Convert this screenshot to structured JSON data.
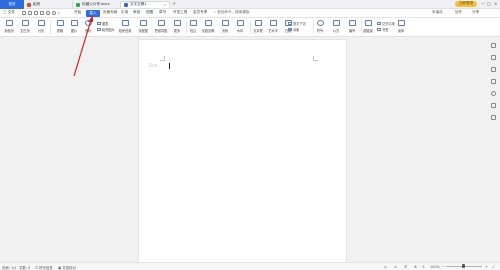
{
  "titlebar": {
    "home_tab": "首页",
    "tabs": [
      {
        "label": "稻壳",
        "color": "#e0442c"
      },
      {
        "label": "珍藏公众号.docx",
        "color": "#2fa84f"
      },
      {
        "label": "文字文稿1",
        "color": "#2d6cdf"
      }
    ],
    "new_tab": "+",
    "login": "立即登录",
    "minimize": "—",
    "maximize": "□",
    "close": "×"
  },
  "menubar": {
    "file": "三 文件",
    "items_left": [
      "开始",
      "插入",
      "页面布局",
      "引用",
      "审阅",
      "视图",
      "章节",
      "开发工具",
      "会员专享"
    ],
    "active": "开始",
    "search": "查找命令、搜索模板",
    "right_links": [
      "未保存",
      "协作",
      "分享"
    ]
  },
  "ribbon": {
    "big_buttons": [
      "封面页",
      "空白页",
      "分页",
      "表格",
      "图片",
      "形状",
      "图标",
      "截屏",
      "稻壳资源",
      "流程图",
      "思维导图",
      "更多",
      "批注",
      "页眉页脚",
      "页码",
      "水印",
      "文本框",
      "艺术字",
      "日期",
      "对象",
      "文档部件",
      "符号",
      "公式",
      "编号",
      "超链接",
      "交叉引用",
      "书签",
      "窗体"
    ],
    "small_items": [
      "图表",
      "在线图表",
      "稻壳图片",
      "附件",
      "首字下沉",
      "插入数字",
      "文档图片",
      "在线脑图"
    ]
  },
  "document": {
    "placeholder": "First.",
    "cursor": "|"
  },
  "statusbar": {
    "page": "页面: 1/1",
    "words": "字数: 0",
    "spell": "拼写检查",
    "doc_check": "文档校对",
    "zoom": "100%"
  },
  "colors": {
    "accent": "#2d6cdf",
    "login_badge": "#f5c13b",
    "arrow": "#d42020"
  }
}
